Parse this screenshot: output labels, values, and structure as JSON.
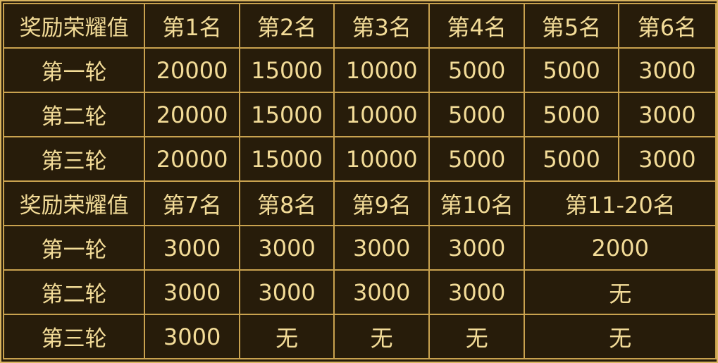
{
  "section1": {
    "header": [
      "奖励荣耀值",
      "第1名",
      "第2名",
      "第3名",
      "第4名",
      "第5名",
      "第6名"
    ],
    "rows": [
      [
        "第一轮",
        "20000",
        "15000",
        "10000",
        "5000",
        "5000",
        "3000"
      ],
      [
        "第二轮",
        "20000",
        "15000",
        "10000",
        "5000",
        "5000",
        "3000"
      ],
      [
        "第三轮",
        "20000",
        "15000",
        "10000",
        "5000",
        "5000",
        "3000"
      ]
    ]
  },
  "section2": {
    "header": [
      "奖励荣耀值",
      "第7名",
      "第8名",
      "第9名",
      "第10名",
      "第11-20名"
    ],
    "rows": [
      [
        "第一轮",
        "3000",
        "3000",
        "3000",
        "3000",
        "2000"
      ],
      [
        "第二轮",
        "3000",
        "3000",
        "3000",
        "3000",
        "无"
      ],
      [
        "第三轮",
        "3000",
        "无",
        "无",
        "无",
        "无"
      ]
    ]
  },
  "colors": {
    "background": "#271c0a",
    "border": "#c9a24f",
    "text": "#f3dc98"
  }
}
